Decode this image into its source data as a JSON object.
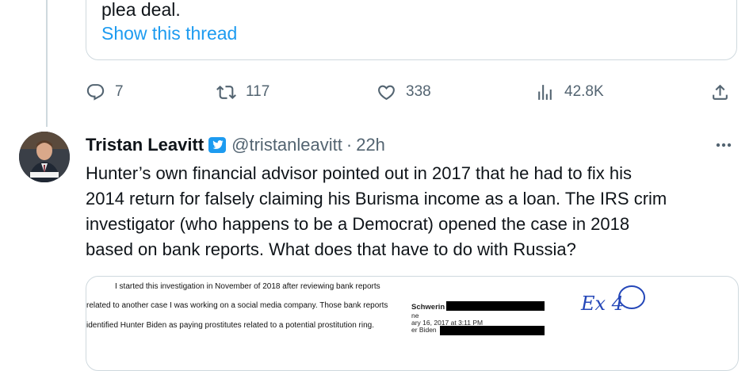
{
  "quoted_tweet": {
    "partial_text": "plea deal.",
    "show_thread_label": "Show this thread"
  },
  "actions": {
    "replies": "7",
    "retweets": "117",
    "likes": "338",
    "views": "42.8K"
  },
  "tweet": {
    "author_name": "Tristan Leavitt",
    "handle": "@tristanleavitt",
    "separator": "·",
    "time": "22h",
    "text": "Hunter’s own financial advisor pointed out in 2017 that he had to fix his\n2014 return for falsely claiming his Burisma income as a loan. The IRS crim\ninvestigator (who happens to be a Democrat) opened the case in 2018\nbased on bank reports. What does that have to do with Russia?",
    "verified_color": "#1d9bf0"
  },
  "media": {
    "line1": "I started this investigation in November of 2018 after reviewing bank reports",
    "line2": "related to another case I was working on a social media company.   Those bank reports",
    "line3": "identified Hunter Biden as paying prostitutes related to a potential prostitution ring.",
    "email_name": "Schwerin",
    "email_sub1": "ne",
    "email_date": "ary 16, 2017 at 3:11 PM",
    "email_to": "er Biden",
    "exhibit_mark": "Ex 4"
  },
  "colors": {
    "accent": "#1d9bf0",
    "secondary_text": "#536471",
    "border": "#cfd9de"
  }
}
